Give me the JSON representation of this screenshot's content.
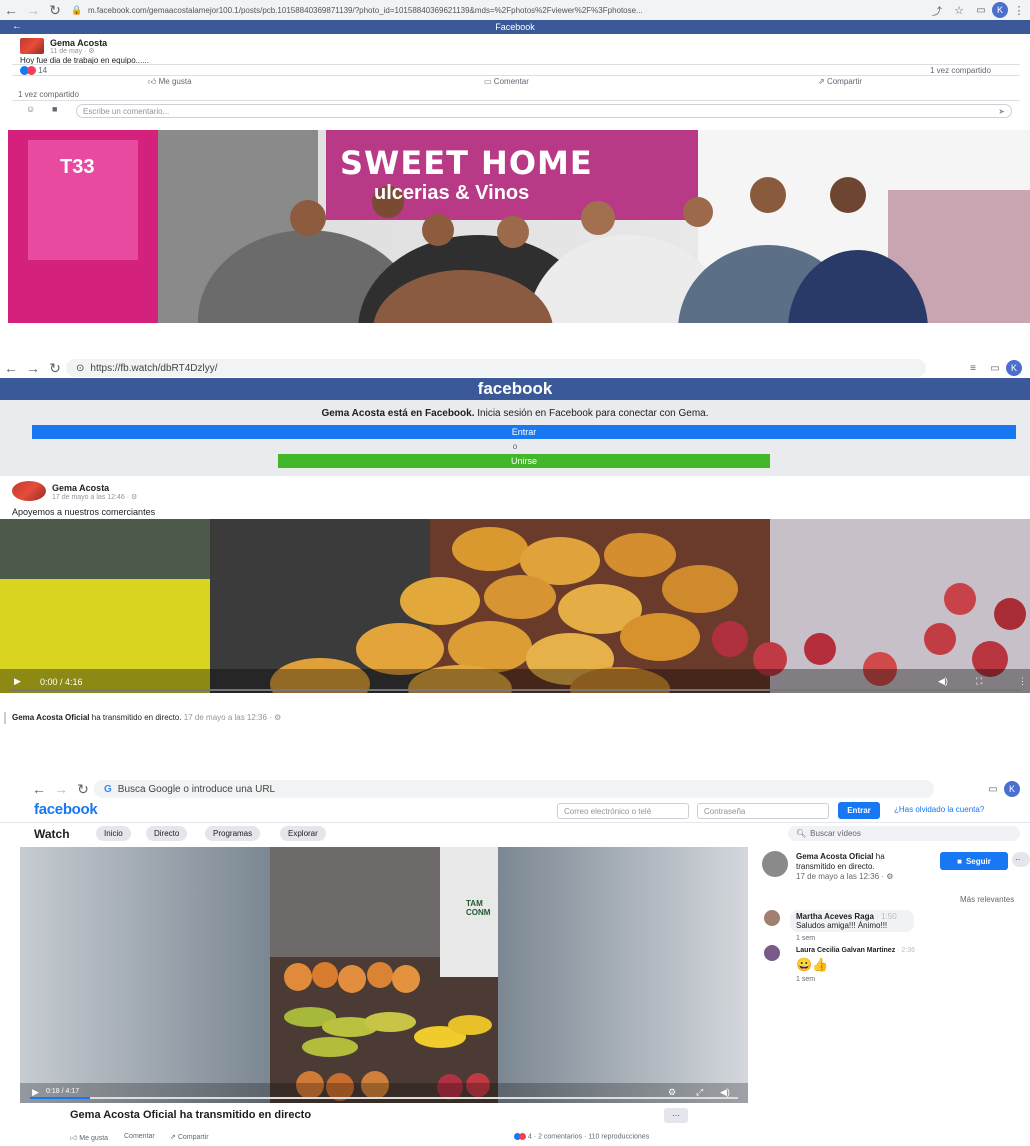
{
  "colors": {
    "fb_blue": "#3b5998",
    "link_blue": "#1877f2",
    "green": "#42b72a"
  },
  "s1": {
    "url": "m.facebook.com/gemaacostalamejor100.1/posts/pcb.1015884036987113​9/?photo_id=10158840369621139&mds=%2Fphotos%2Fviewer%2F%3Fphotose...",
    "bar_title": "Facebook",
    "author": "Gema Acosta",
    "date": "11 de may · ⚙",
    "text": "Hoy fue dia de trabajo en equipo......",
    "reactions": "14",
    "shares": "1 vez compartido",
    "like": "Me gusta",
    "comment": "Comentar",
    "share": "Compartir",
    "shared_line": "1 vez compartido",
    "comment_placeholder": "Escribe un comentario...",
    "sign_line1": "SWEET HOME",
    "sign_line2": "ulcerias & Vinos",
    "door_sign": "T33"
  },
  "s2": {
    "url": "https://fb.watch/dbRT4Dzlyy/",
    "logo": "facebook",
    "prompt_bold": "Gema Acosta está en Facebook.",
    "prompt_rest": " Inicia sesión en Facebook para conectar con Gema.",
    "login": "Entrar",
    "or": "o",
    "join": "Unirse",
    "author": "Gema Acosta",
    "date": "17 de mayo a las 12:46 · ⚙",
    "text": "Apoyemos a nuestros comerciantes",
    "time": "0:00 / 4:16",
    "footer_bold": "Gema Acosta Oficial",
    "footer_rest": " ha transmitido en directo.",
    "footer_date": " 17 de mayo a las 12:36 · ⚙"
  },
  "s3": {
    "omnibox": "Busca Google o introduce una URL",
    "logo": "facebook",
    "email_placeholder": "Correo electrónico o telé",
    "password_placeholder": "Contraseña",
    "login": "Entrar",
    "forgot": "¿Has olvidado la cuenta?",
    "watch": "Watch",
    "tabs": [
      "Inicio",
      "Directo",
      "Programas",
      "Explorar"
    ],
    "search_placeholder": "Buscar vídeos",
    "page_name": "Gema Acosta Oficial",
    "page_rest": " ha",
    "page_line2": "transmitido en directo.",
    "page_date": "17 de mayo a las 12:36 · ⚙",
    "follow": "Seguir",
    "sort": "Más relevantes",
    "comments": [
      {
        "name": "Martha Aceves Raga",
        "time": "· 1:50",
        "text": "Saludos amiga!!! Ánimo!!!",
        "ago": "1 sem"
      },
      {
        "name": "Laura Cecilia Galvan Martinez",
        "time": "· 2:36",
        "text": "😀👍",
        "ago": "1 sem"
      }
    ],
    "video_time": "0:18 / 4:17",
    "truck_text": "TAM CONM",
    "video_title": "Gema Acosta Oficial ha transmitido en directo",
    "more": "···",
    "like": "Me gusta",
    "comment": "Comentar",
    "share": "Compartir",
    "stats": "4 · 2 comentarios · 110 reproducciones"
  }
}
